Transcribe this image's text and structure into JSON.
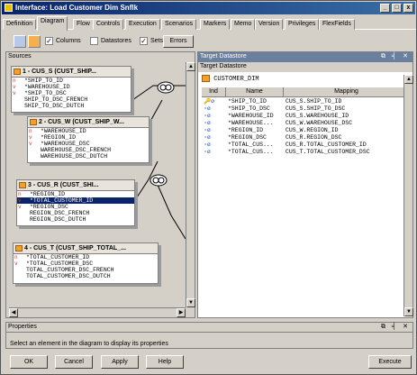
{
  "window": {
    "title": "Interface: Load Customer Dim Snflk",
    "minimize": "_",
    "restore": "□",
    "close": "x"
  },
  "tabs": [
    {
      "label": "Definition"
    },
    {
      "label": "Diagram"
    },
    {
      "label": "Flow"
    },
    {
      "label": "Controls"
    },
    {
      "label": "Execution"
    },
    {
      "label": "Scenarios"
    },
    {
      "label": "Markers"
    },
    {
      "label": "Memo"
    },
    {
      "label": "Version"
    },
    {
      "label": "Privileges"
    },
    {
      "label": "FlexFields"
    }
  ],
  "active_tab": "Diagram",
  "toolbar": {
    "columns_label": "Columns",
    "columns_checked": true,
    "datastores_label": "Datastores",
    "datastores_checked": false,
    "sets_label": "Sets",
    "sets_checked": true,
    "errors_label": "Errors"
  },
  "sources": {
    "header": "Sources",
    "datastores": [
      {
        "title": "1 - CUS_S (CUST_SHIP...",
        "rows": [
          {
            "tag": "n",
            "text": "*SHIP_TO_ID"
          },
          {
            "tag": "v",
            "text": "*WAREHOUSE_ID"
          },
          {
            "tag": "v",
            "text": "*SHIP_TO_DSC"
          },
          {
            "tag": "",
            "text": "SHIP_TO_DSC_FRENCH"
          },
          {
            "tag": "",
            "text": "SHIP_TO_DSC_DUTCH"
          }
        ]
      },
      {
        "title": "2 - CUS_W (CUST_SHIP_W...",
        "rows": [
          {
            "tag": "n",
            "text": "*WAREHOUSE_ID"
          },
          {
            "tag": "v",
            "text": "*REGION_ID"
          },
          {
            "tag": "v",
            "text": "*WAREHOUSE_DSC"
          },
          {
            "tag": "",
            "text": "WAREHOUSE_DSC_FRENCH"
          },
          {
            "tag": "",
            "text": "WAREHOUSE_DSC_DUTCH"
          }
        ]
      },
      {
        "title": "3 - CUS_R (CUST_SHI...",
        "rows": [
          {
            "tag": "n",
            "text": "*REGION_ID"
          },
          {
            "tag": "v",
            "text": "*TOTAL_CUSTOMER_ID",
            "selected": true
          },
          {
            "tag": "v",
            "text": "*REGION_DSC"
          },
          {
            "tag": "",
            "text": "REGION_DSC_FRENCH"
          },
          {
            "tag": "",
            "text": "REGION_DSC_DUTCH"
          }
        ]
      },
      {
        "title": "4 - CUS_T (CUST_SHIP_TOTAL_...",
        "rows": [
          {
            "tag": "n",
            "text": "*TOTAL_CUSTOMER_ID"
          },
          {
            "tag": "v",
            "text": "*TOTAL_CUSTOMER_DSC"
          },
          {
            "tag": "",
            "text": "TOTAL_CUSTOMER_DSC_FRENCH"
          },
          {
            "tag": "",
            "text": "TOTAL_CUSTOMER_DSC_DUTCH"
          }
        ]
      }
    ]
  },
  "target": {
    "header": "Target Datastore",
    "subheader": "Target Datastore",
    "datastore_name": "CUSTOMER_DIM",
    "columns": [
      "Ind",
      "Name",
      "Mapping"
    ],
    "rows": [
      {
        "name": "*SHIP_TO_ID",
        "mapping": "CUS_S.SHIP_TO_ID"
      },
      {
        "name": "*SHIP_TO_DSC",
        "mapping": "CUS_S.SHIP_TO_DSC"
      },
      {
        "name": "*WAREHOUSE_ID",
        "mapping": "CUS_S.WAREHOUSE_ID"
      },
      {
        "name": "*WAREHOUSE...",
        "mapping": "CUS_W.WAREHOUSE_DSC"
      },
      {
        "name": "*REGION_ID",
        "mapping": "CUS_W.REGION_ID"
      },
      {
        "name": "*REGION_DSC",
        "mapping": "CUS_R.REGION_DSC"
      },
      {
        "name": "*TOTAL_CUS...",
        "mapping": "CUS_R.TOTAL_CUSTOMER_ID"
      },
      {
        "name": "*TOTAL_CUS...",
        "mapping": "CUS_T.TOTAL_CUSTOMER_DSC"
      }
    ]
  },
  "properties": {
    "header": "Properties",
    "message": "Select an element in the diagram to display its properties"
  },
  "buttons": {
    "ok": "OK",
    "cancel": "Cancel",
    "apply": "Apply",
    "help": "Help",
    "execute": "Execute"
  },
  "colors": {
    "title_bar": "#0a246a",
    "panel_head": "#6b7f9e",
    "selection": "#0a246a",
    "datastore_icon": "#f2a02a"
  }
}
